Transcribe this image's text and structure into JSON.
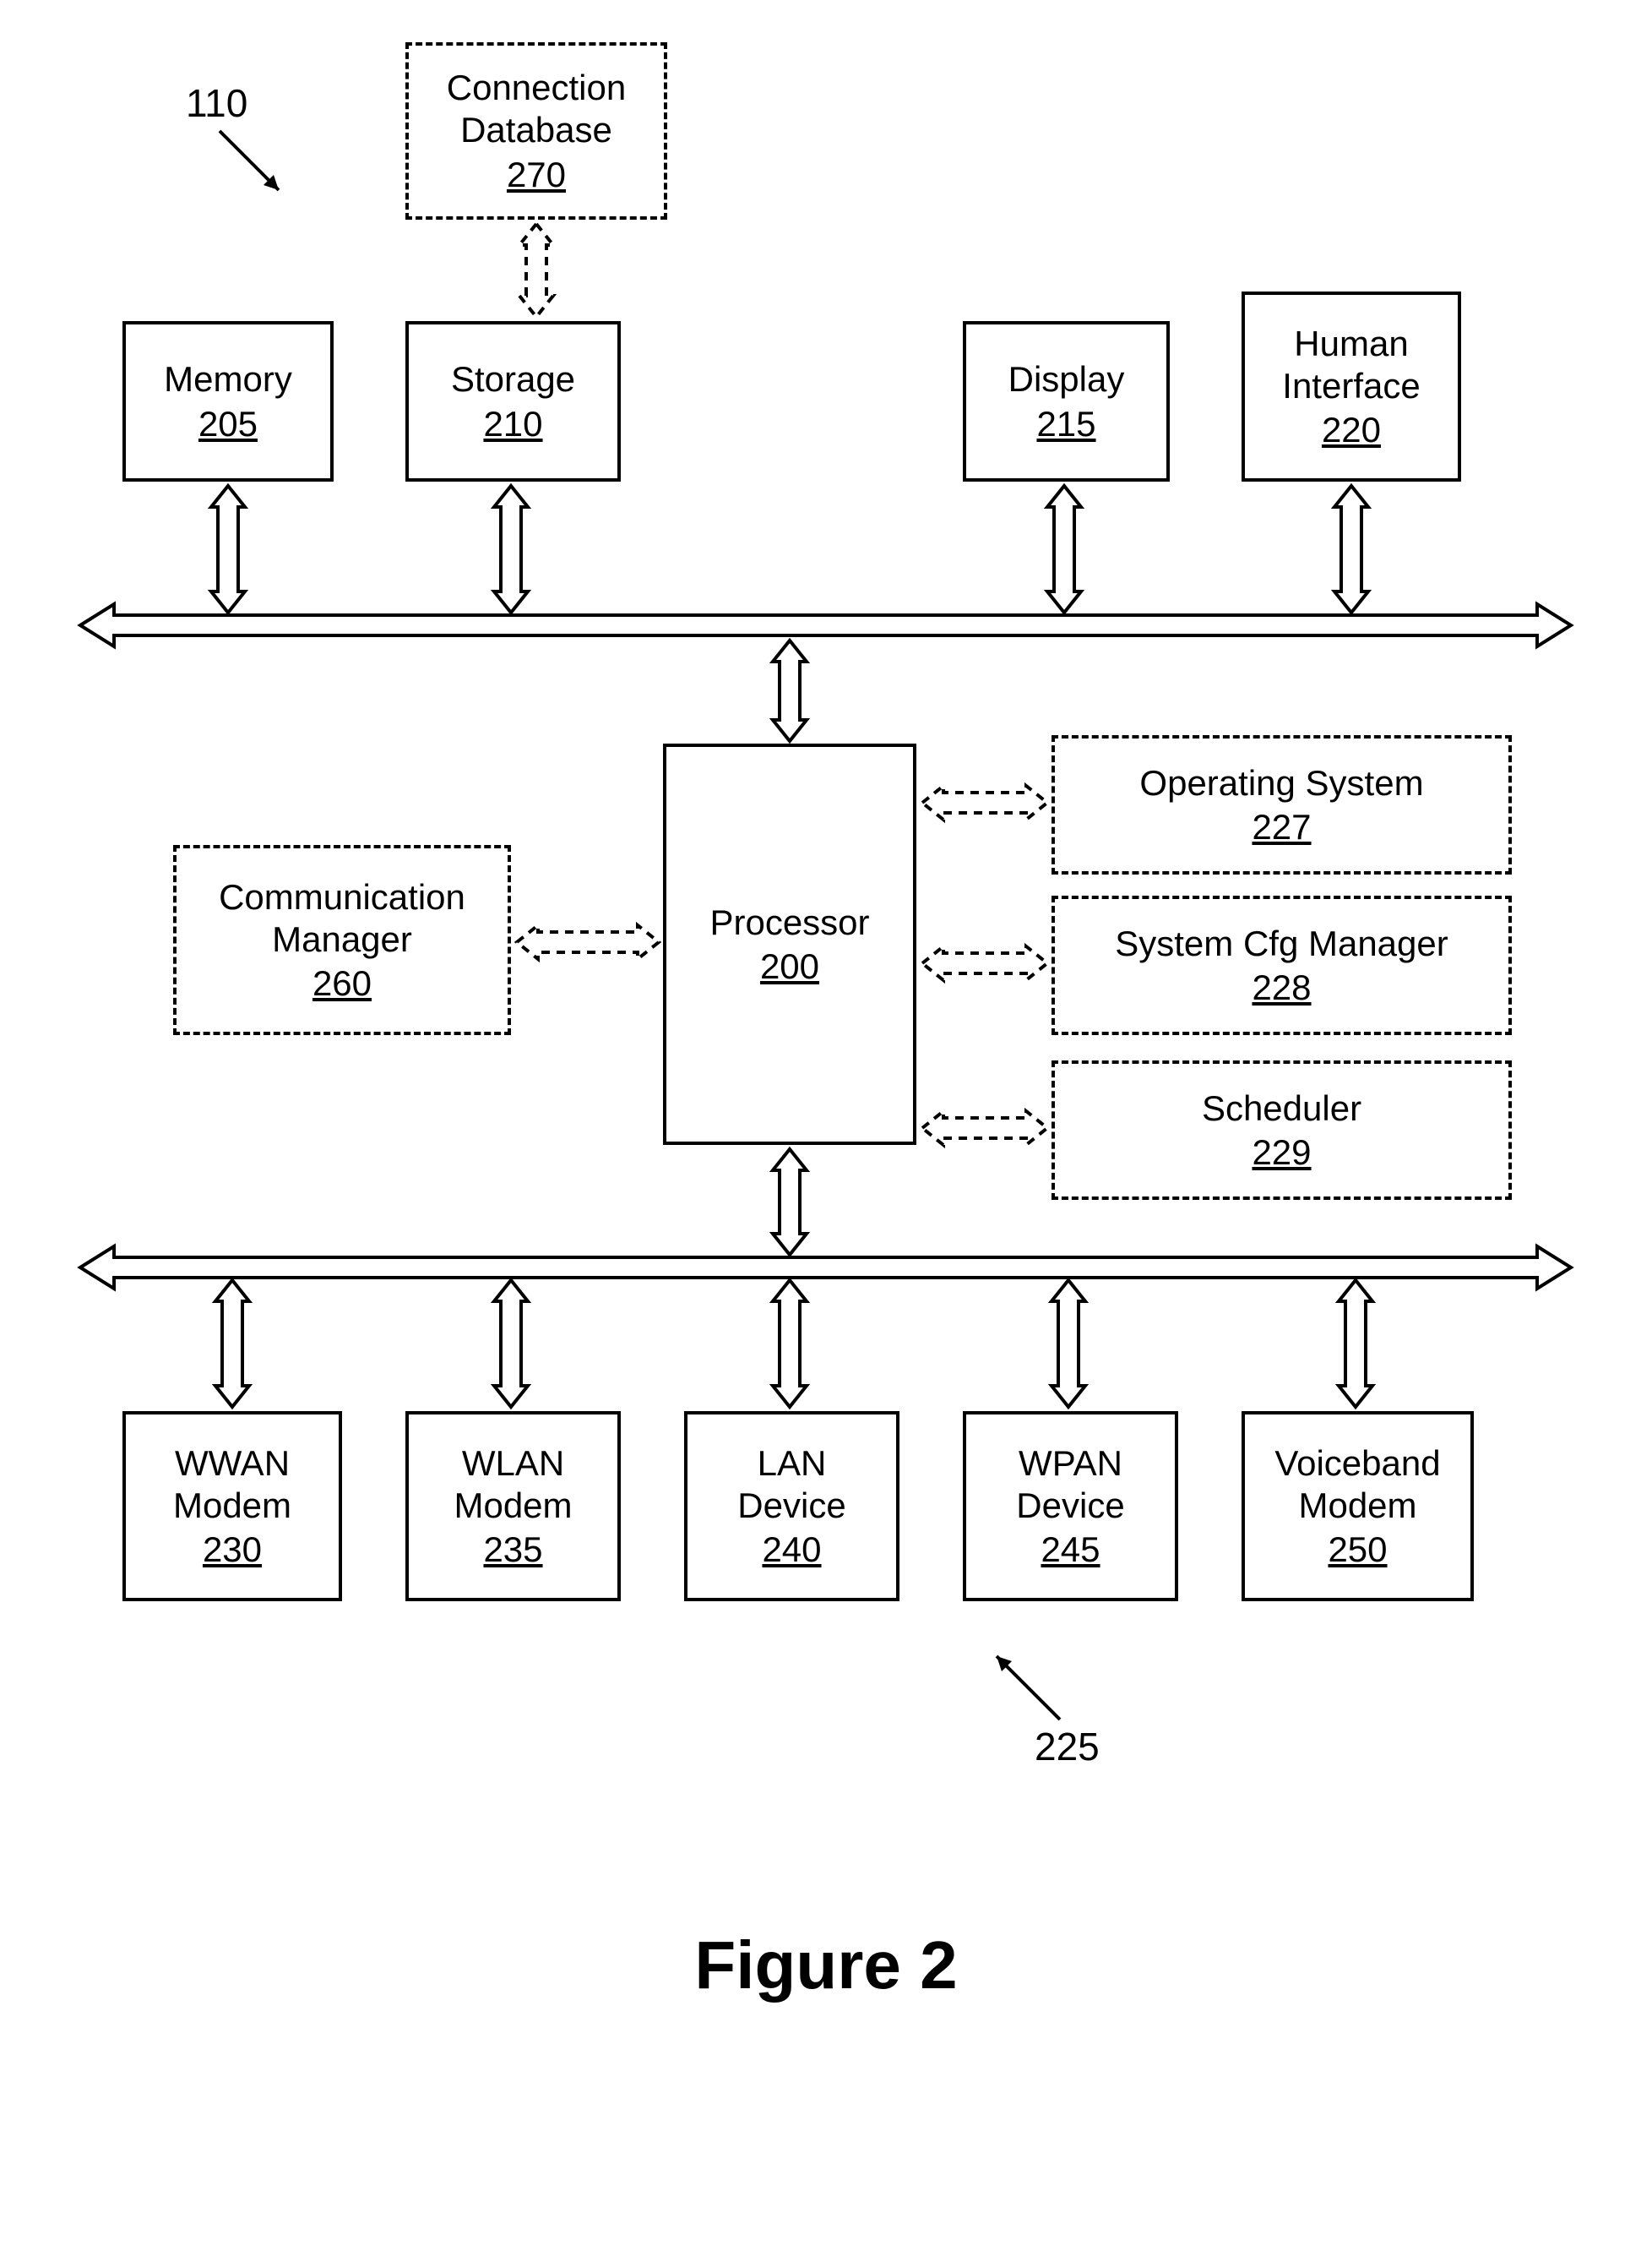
{
  "figure_label": "Figure 2",
  "annotation_110": "110",
  "annotation_225": "225",
  "boxes": {
    "connection_db": {
      "title": "Connection\nDatabase",
      "ref": "270"
    },
    "memory": {
      "title": "Memory",
      "ref": "205"
    },
    "storage": {
      "title": "Storage",
      "ref": "210"
    },
    "display": {
      "title": "Display",
      "ref": "215"
    },
    "human_if": {
      "title": "Human\nInterface",
      "ref": "220"
    },
    "comm_mgr": {
      "title": "Communication\nManager",
      "ref": "260"
    },
    "processor": {
      "title": "Processor",
      "ref": "200"
    },
    "os": {
      "title": "Operating System",
      "ref": "227"
    },
    "syscfg": {
      "title": "System Cfg Manager",
      "ref": "228"
    },
    "scheduler": {
      "title": "Scheduler",
      "ref": "229"
    },
    "wwan": {
      "title": "WWAN\nModem",
      "ref": "230"
    },
    "wlan": {
      "title": "WLAN\nModem",
      "ref": "235"
    },
    "lan": {
      "title": "LAN\nDevice",
      "ref": "240"
    },
    "wpan": {
      "title": "WPAN\nDevice",
      "ref": "245"
    },
    "voiceband": {
      "title": "Voiceband\nModem",
      "ref": "250"
    }
  }
}
